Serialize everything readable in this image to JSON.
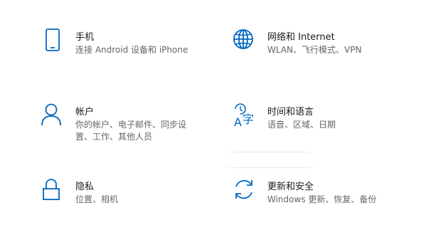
{
  "accent_color": "#0067c0",
  "tiles": [
    {
      "icon": "phone-icon",
      "title": "手机",
      "desc": "连接 Android 设备和 iPhone"
    },
    {
      "icon": "globe-icon",
      "title": "网络和 Internet",
      "desc": "WLAN、飞行模式、VPN"
    },
    {
      "icon": "person-icon",
      "title": "帐户",
      "desc": "你的帐户、电子邮件、同步设置、工作、其他人员"
    },
    {
      "icon": "time-language-icon",
      "title": "时间和语言",
      "desc": "语音、区域、日期"
    },
    {
      "icon": "lock-icon",
      "title": "隐私",
      "desc": "位置、相机"
    },
    {
      "icon": "sync-icon",
      "title": "更新和安全",
      "desc": "Windows 更新、恢复、备份"
    }
  ],
  "time_language_glyph": {
    "latin": "A",
    "cjk": "字"
  }
}
